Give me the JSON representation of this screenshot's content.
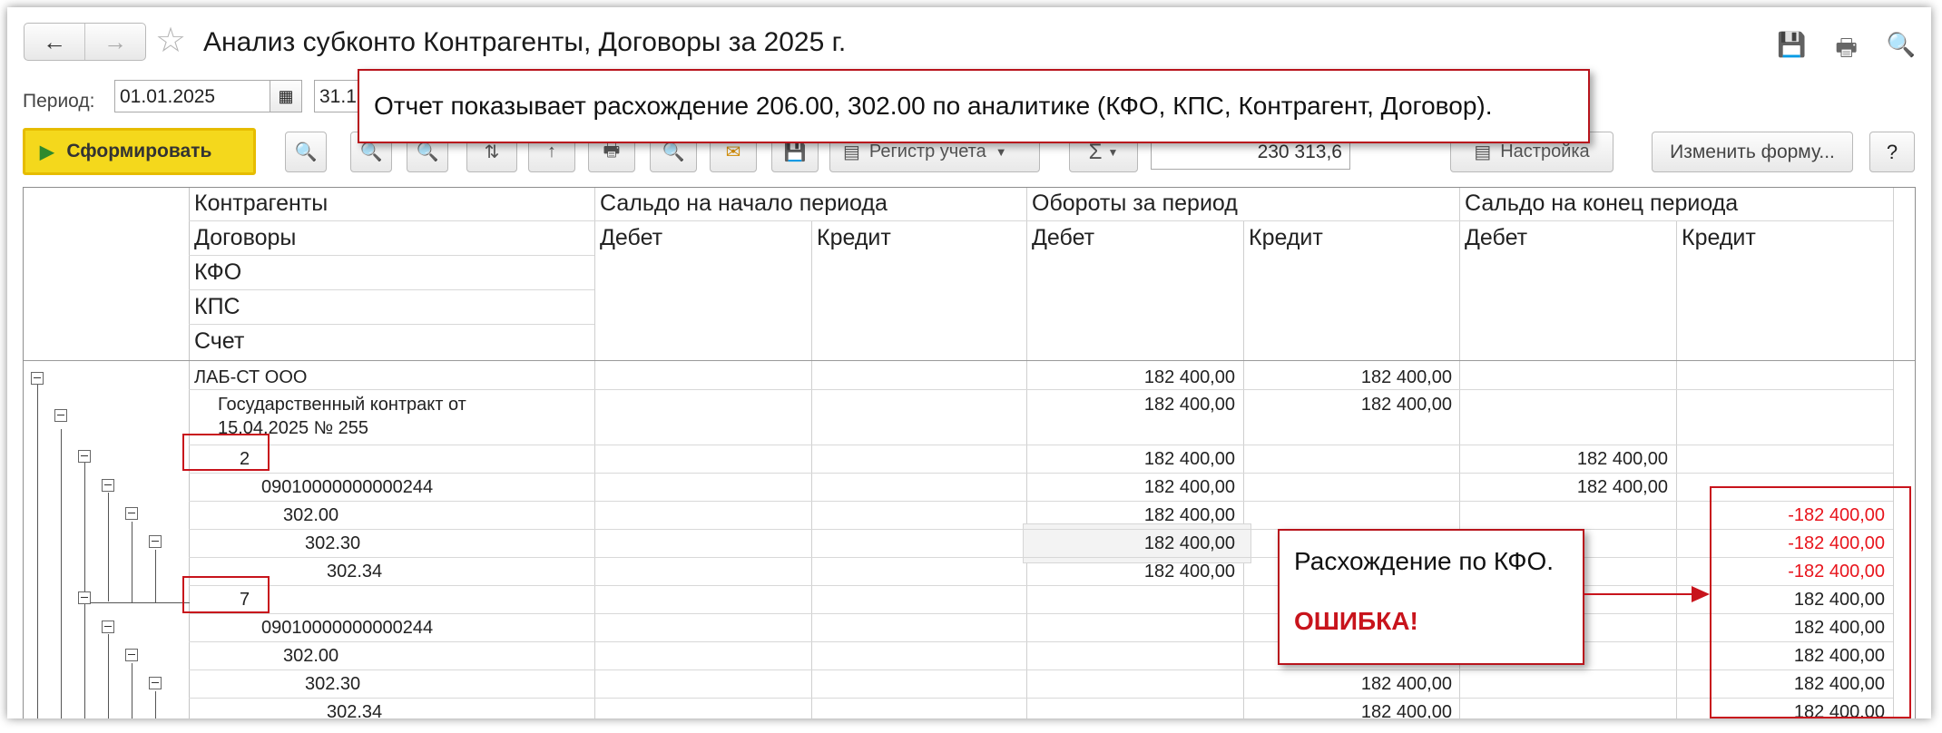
{
  "window": {
    "title": "Анализ субконто Контрагенты, Договоры за 2025 г.",
    "back_icon": "←",
    "forward_icon": "→",
    "star_icon": "☆",
    "toolbar_icons": [
      "💾",
      "🖶",
      "🔍",
      "🔗"
    ]
  },
  "period": {
    "label": "Период:",
    "from": "01.01.2025",
    "to": "31.1"
  },
  "toolbar": {
    "generate_label": "Сформировать",
    "register_label": "Регистр учета",
    "sum_label": "Σ",
    "amount_value": "230 313,6",
    "settings_label": "Настройка",
    "change_form_label": "Изменить форму...",
    "help_label": "?"
  },
  "colors": {
    "accent_yellow": "#f4d81c",
    "annotation_red": "#c8141c",
    "negative_red": "#e8141c"
  },
  "table": {
    "grouping_headers": [
      "Контрагенты",
      "Договоры",
      "КФО",
      "КПС",
      "Счет"
    ],
    "column_groups": [
      "Сальдо на начало периода",
      "Обороты за период",
      "Сальдо на конец периода"
    ],
    "sub_headers": [
      "Дебет",
      "Кредит",
      "Дебет",
      "Кредит",
      "Дебет",
      "Кредит"
    ],
    "rows": [
      {
        "label": "ЛАБ-СТ ООО",
        "turn_debit": "182 400,00",
        "turn_credit": "182 400,00",
        "end_debit": "",
        "end_credit": ""
      },
      {
        "label": "Государственный контракт от",
        "label2": "15.04.2025 № 255",
        "turn_debit": "182 400,00",
        "turn_credit": "182 400,00",
        "end_debit": "",
        "end_credit": ""
      },
      {
        "label": "2",
        "turn_debit": "182 400,00",
        "turn_credit": "",
        "end_debit": "182 400,00",
        "end_credit": ""
      },
      {
        "label": "09010000000000244",
        "turn_debit": "182 400,00",
        "turn_credit": "",
        "end_debit": "182 400,00",
        "end_credit": ""
      },
      {
        "label": "302.00",
        "turn_debit": "182 400,00",
        "turn_credit": "",
        "end_debit": "",
        "end_credit": "-182 400,00"
      },
      {
        "label": "302.30",
        "turn_debit": "182 400,00",
        "turn_credit": "",
        "end_debit": "",
        "end_credit": "-182 400,00"
      },
      {
        "label": "302.34",
        "turn_debit": "182 400,00",
        "turn_credit": "",
        "end_debit": "",
        "end_credit": "-182 400,00"
      },
      {
        "label": "7",
        "turn_debit": "",
        "turn_credit": "",
        "end_debit": "",
        "end_credit": "182 400,00"
      },
      {
        "label": "09010000000000244",
        "turn_debit": "",
        "turn_credit": "",
        "end_debit": "",
        "end_credit": "182 400,00"
      },
      {
        "label": "302.00",
        "turn_debit": "",
        "turn_credit": "",
        "end_debit": "",
        "end_credit": "182 400,00"
      },
      {
        "label": "302.30",
        "turn_debit": "",
        "turn_credit": "182 400,00",
        "end_debit": "",
        "end_credit": "182 400,00"
      },
      {
        "label": "302.34",
        "turn_debit": "",
        "turn_credit": "182 400,00",
        "end_debit": "",
        "end_credit": "182 400,00"
      }
    ]
  },
  "annotations": {
    "top_note": "Отчет показывает расхождение 206.00, 302.00 по аналитике (КФО, КПС, Контрагент, Договор).",
    "kfo_note": "Расхождение по КФО.",
    "error_note": "ОШИБКА!"
  }
}
